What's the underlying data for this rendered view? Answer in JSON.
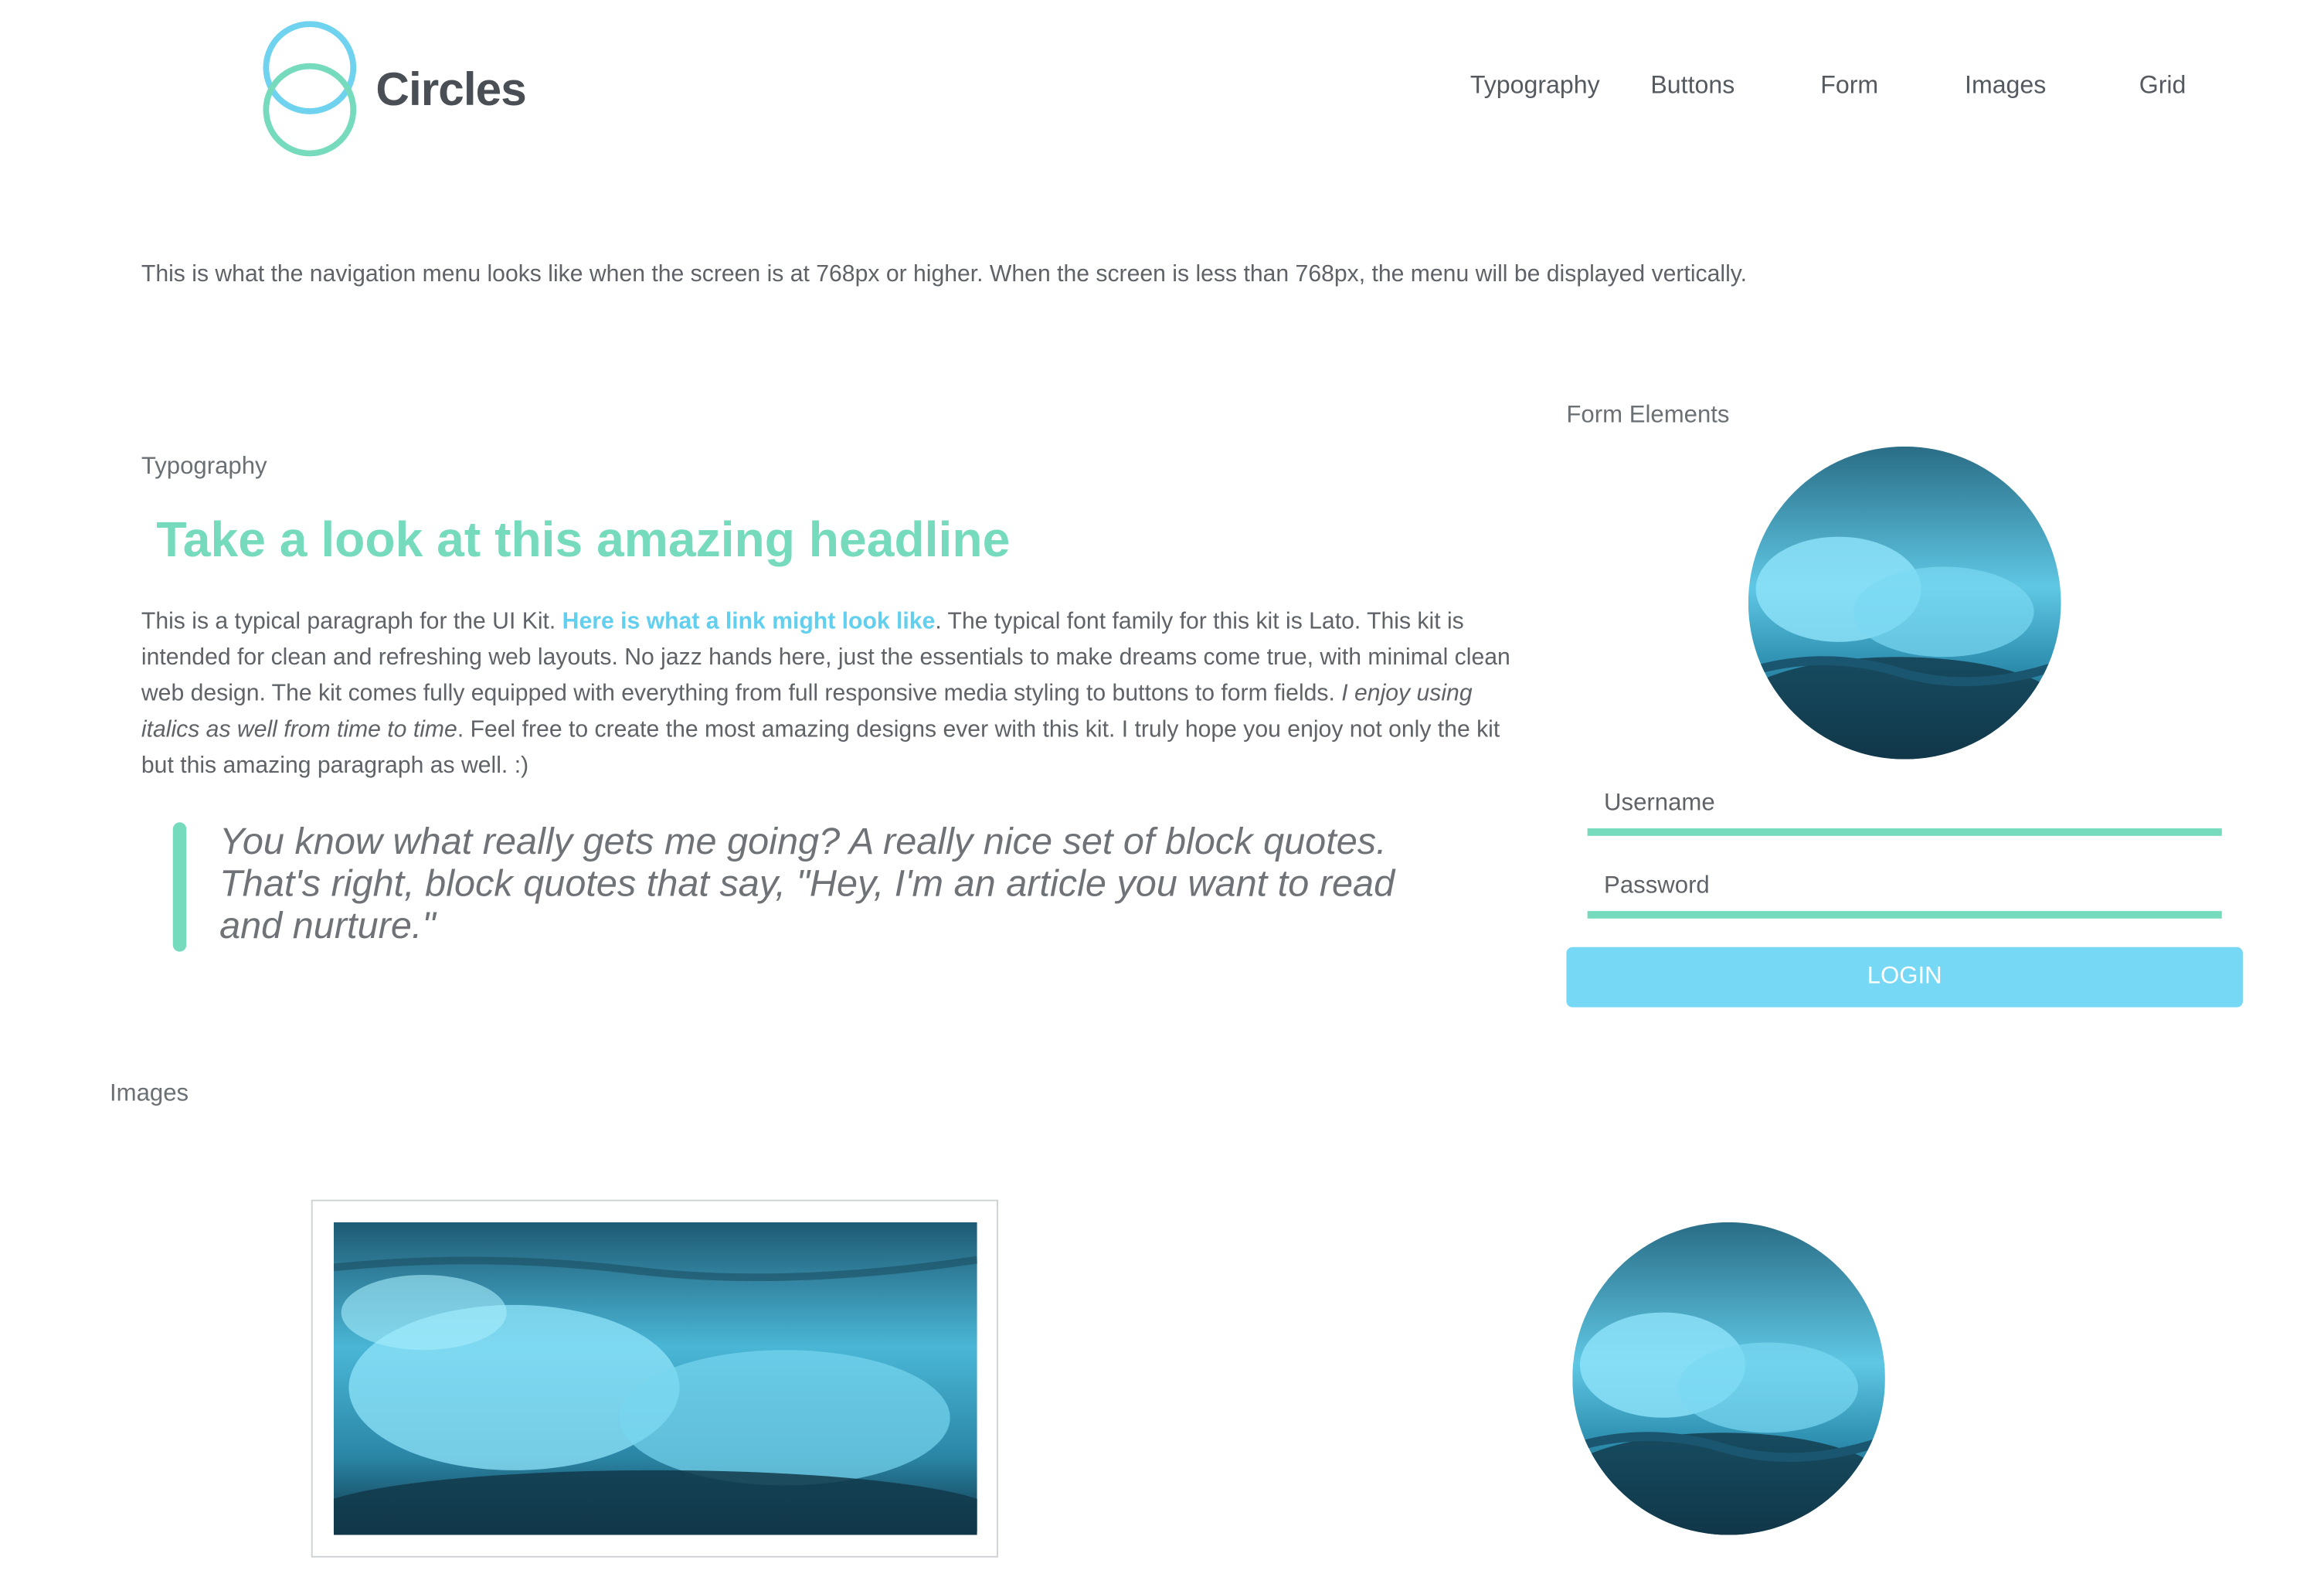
{
  "header": {
    "logo_text": "Circles",
    "nav": [
      "Typography",
      "Buttons",
      "Form",
      "Images",
      "Grid"
    ]
  },
  "intro": "This is what the navigation menu looks like when the screen is at 768px or higher. When the screen is less than 768px, the menu will be displayed vertically.",
  "typography": {
    "label": "Typography",
    "headline": "Take a look at this amazing headline",
    "paragraph": {
      "start": "This is a typical paragraph for the UI Kit. ",
      "link": "Here is what a link might look like",
      "middle": ". The typical font family for this kit is Lato. This kit is intended for clean and refreshing web layouts. No jazz hands here, just the essentials to make dreams come true, with minimal clean web design. The kit comes fully equipped with everything from full responsive media styling to buttons to form fields. ",
      "italic": "I enjoy using italics as well from time to time",
      "end": ". Feel free to create the most amazing designs ever with this kit. I truly hope you enjoy not only the kit but this amazing paragraph as well. :)"
    },
    "blockquote": "You know what really gets me going? A really nice set of block quotes. That's right, block quotes that say, \"Hey, I'm an article you want to read and nurture.\""
  },
  "form": {
    "label": "Form Elements",
    "username_placeholder": "Username",
    "password_placeholder": "Password",
    "login_label": "LOGIN"
  },
  "images": {
    "label": "Images"
  },
  "colors": {
    "accent_green": "#76dbbd",
    "accent_blue": "#76d8f5",
    "link_blue": "#62cfee",
    "text_gray": "#5f6368"
  },
  "icons": {
    "logo": "two-overlapping-circles-logo-icon",
    "wave_image": "ocean-wave-photo"
  }
}
